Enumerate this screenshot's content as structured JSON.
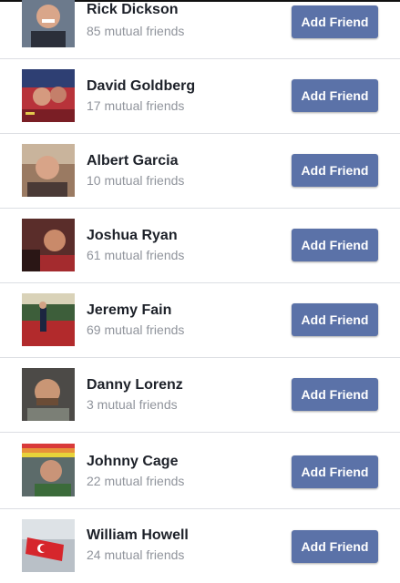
{
  "friends_list": {
    "button_label": "Add Friend",
    "items": [
      {
        "name": "Rick Dickson",
        "mutual": "85 mutual friends",
        "avatar": "profile-photo"
      },
      {
        "name": "David Goldberg",
        "mutual": "17 mutual friends",
        "avatar": "profile-photo"
      },
      {
        "name": "Albert Garcia",
        "mutual": "10 mutual friends",
        "avatar": "profile-photo"
      },
      {
        "name": "Joshua Ryan",
        "mutual": "61 mutual friends",
        "avatar": "profile-photo"
      },
      {
        "name": "Jeremy Fain",
        "mutual": "69 mutual friends",
        "avatar": "profile-photo"
      },
      {
        "name": "Danny Lorenz",
        "mutual": "3 mutual friends",
        "avatar": "profile-photo"
      },
      {
        "name": "Johnny Cage",
        "mutual": "22 mutual friends",
        "avatar": "profile-photo"
      },
      {
        "name": "William Howell",
        "mutual": "24 mutual friends",
        "avatar": "profile-photo"
      }
    ]
  },
  "colors": {
    "button_background": "#5b72a8",
    "button_text": "#ffffff",
    "name_text": "#1d2129",
    "mutual_text": "#90949c",
    "divider": "#dcdee3"
  }
}
